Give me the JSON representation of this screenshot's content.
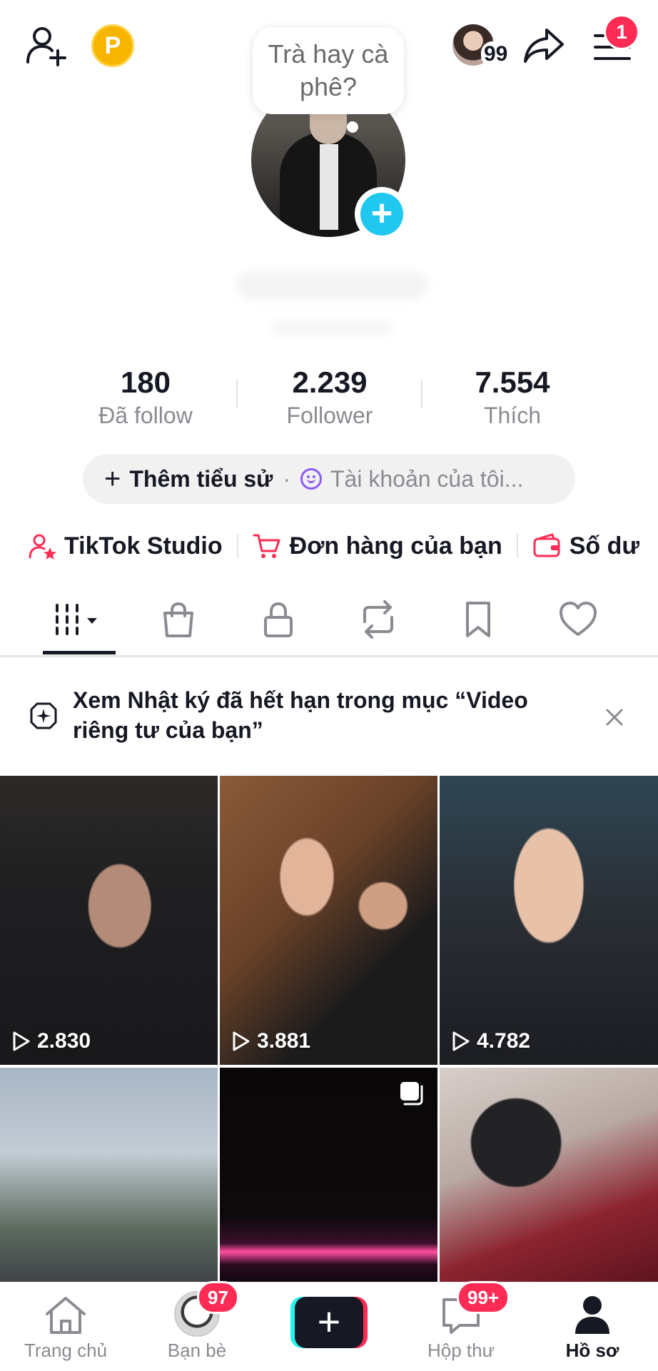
{
  "header": {
    "coin_label": "P",
    "notif_count": "99",
    "menu_badge": "1"
  },
  "note": {
    "text": "Trà hay cà phê?"
  },
  "stats": [
    {
      "value": "180",
      "label": "Đã follow"
    },
    {
      "value": "2.239",
      "label": "Follower"
    },
    {
      "value": "7.554",
      "label": "Thích"
    }
  ],
  "bio": {
    "add_label": "Thêm tiểu sử",
    "separator": "·",
    "account_label": "Tài khoản của tôi..."
  },
  "links": [
    {
      "label": "TikTok Studio",
      "icon": "person-star-icon"
    },
    {
      "label": "Đơn hàng của bạn",
      "icon": "cart-icon"
    },
    {
      "label": "Số dư",
      "icon": "wallet-icon"
    }
  ],
  "tabs": [
    "videos-grid",
    "shop",
    "private",
    "reposts",
    "favorites",
    "liked"
  ],
  "notice": {
    "text": "Xem Nhật ký đã hết hạn trong mục “Video riêng tư của bạn”"
  },
  "videos": [
    {
      "views": "2.830"
    },
    {
      "views": "3.881"
    },
    {
      "views": "4.782"
    },
    {
      "views": ""
    },
    {
      "views": ""
    },
    {
      "views": ""
    }
  ],
  "nav": {
    "home": "Trang chủ",
    "friends": "Bạn bè",
    "friends_badge": "97",
    "create": "+",
    "inbox": "Hộp thư",
    "inbox_badge": "99+",
    "profile": "Hồ sơ"
  },
  "colors": {
    "accent": "#fe2c55",
    "cyan": "#25f4ee",
    "text": "#161823",
    "muted": "#8a8b91"
  }
}
